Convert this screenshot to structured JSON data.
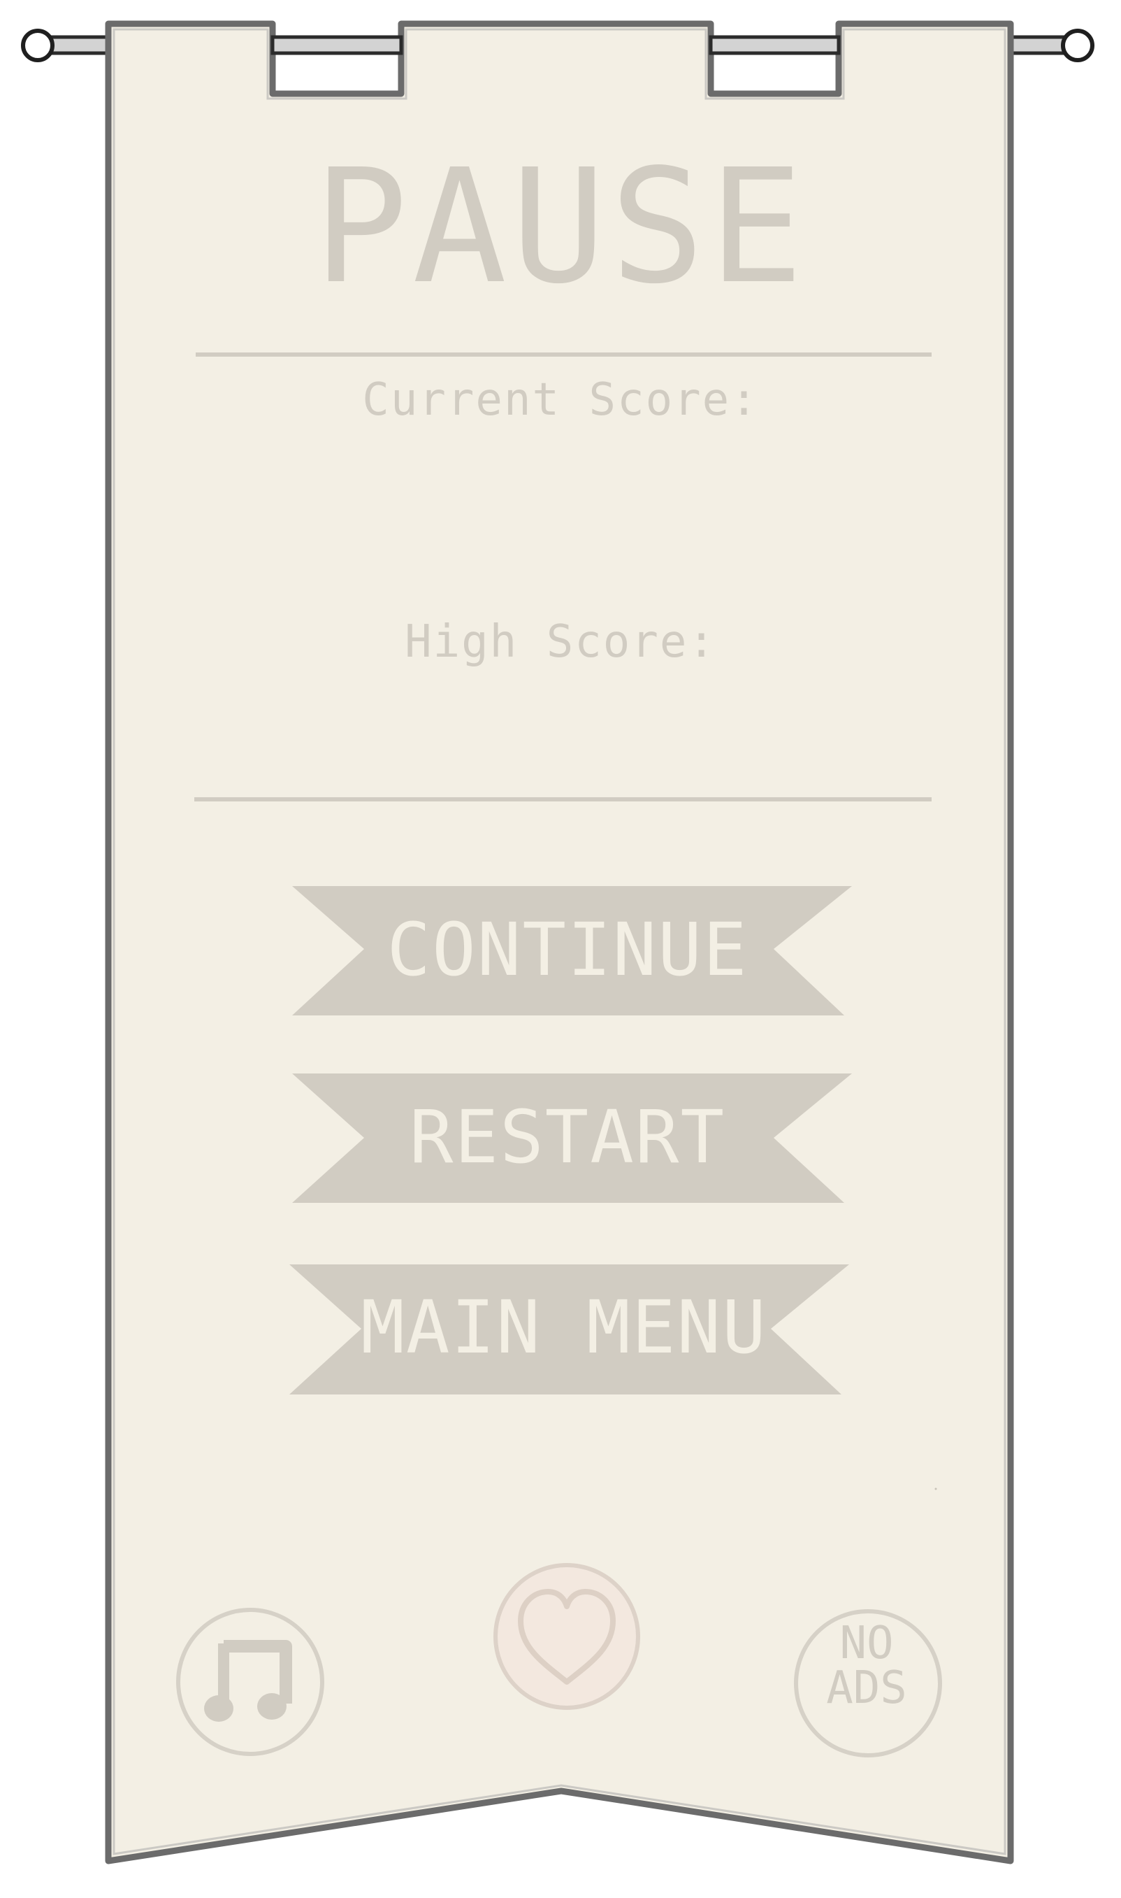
{
  "pause_menu": {
    "title": "PAUSE",
    "current_score_label": "Current Score:",
    "high_score_label": "High Score:",
    "buttons": {
      "continue": "CONTINUE",
      "restart": "RESTART",
      "main_menu": "MAIN MENU"
    },
    "icon_buttons": {
      "music": "music-note-icon",
      "like": "heart-icon",
      "no_ads": "NO ADS"
    }
  },
  "colors": {
    "banner_fill": "#f3efe4",
    "banner_outline": "#6b6b6b",
    "text_muted": "#d1ccc2",
    "button_fill": "#d1ccc2",
    "button_text": "#f3efe4",
    "heart_circle_fill": "#f3e8df",
    "heart_circle_stroke": "#ddd2c8",
    "rod": "#c9c9c9"
  }
}
